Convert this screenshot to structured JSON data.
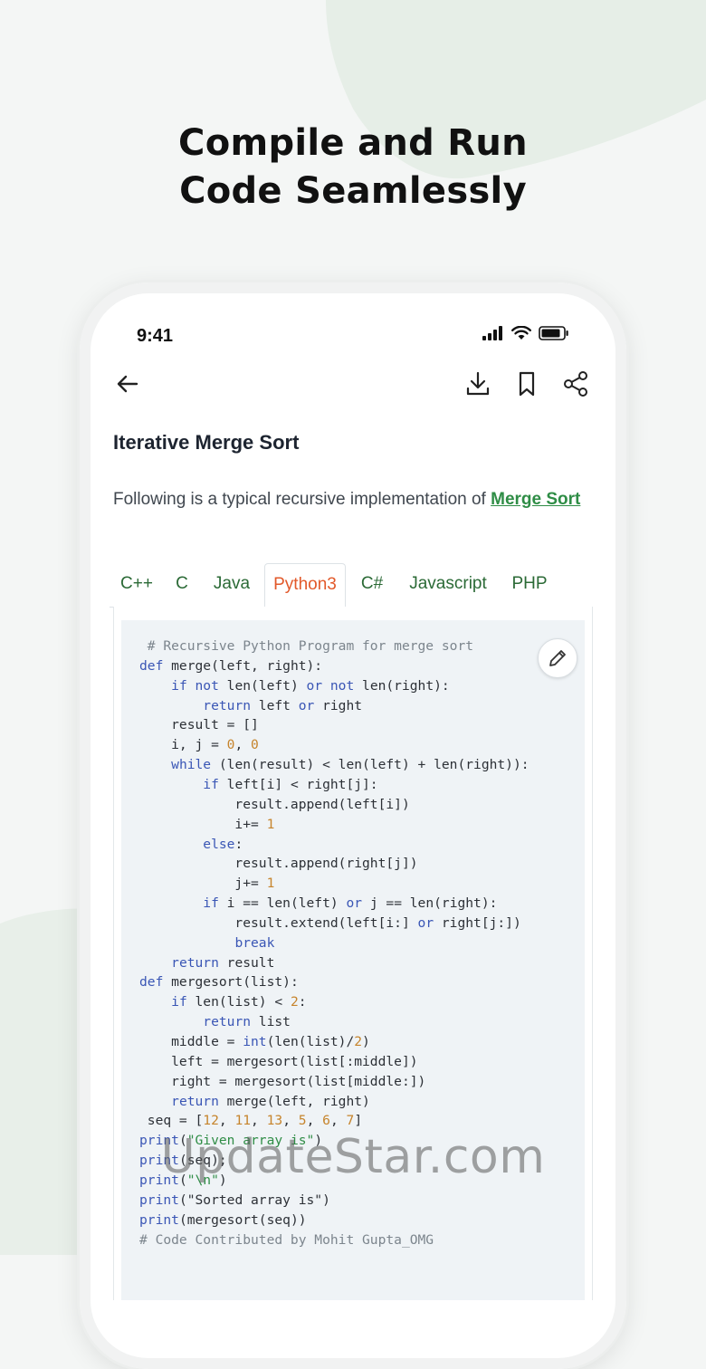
{
  "headline": {
    "line1": "Compile and Run",
    "line2": "Code Seamlessly"
  },
  "status_bar": {
    "time": "9:41"
  },
  "toolbar": {
    "back_icon": "arrow-left-icon",
    "download_icon": "download-icon",
    "bookmark_icon": "bookmark-icon",
    "share_icon": "share-icon"
  },
  "article": {
    "title": "Iterative Merge Sort",
    "intro_text": "Following is a typical recursive implementation of ",
    "intro_link": "Merge Sort"
  },
  "tabs": [
    {
      "label": "C++",
      "active": false
    },
    {
      "label": "C",
      "active": false
    },
    {
      "label": "Java",
      "active": false
    },
    {
      "label": "Python3",
      "active": true
    },
    {
      "label": "C#",
      "active": false
    },
    {
      "label": "Javascript",
      "active": false
    },
    {
      "label": "PHP",
      "active": false
    }
  ],
  "code": {
    "edit_icon": "pencil-icon",
    "lines": [
      [
        [
          "c",
          " # Recursive Python Program for merge sort"
        ]
      ],
      [
        [
          "k",
          "def"
        ],
        [
          "t",
          " merge(left, right):"
        ]
      ],
      [
        [
          "t",
          "    "
        ],
        [
          "k",
          "if not"
        ],
        [
          "t",
          " len(left) "
        ],
        [
          "k",
          "or not"
        ],
        [
          "t",
          " len(right):"
        ]
      ],
      [
        [
          "t",
          "        "
        ],
        [
          "k",
          "return"
        ],
        [
          "t",
          " left "
        ],
        [
          "k",
          "or"
        ],
        [
          "t",
          " right"
        ]
      ],
      [
        [
          "t",
          "    result = []"
        ]
      ],
      [
        [
          "t",
          "    i, j = "
        ],
        [
          "n",
          "0"
        ],
        [
          "t",
          ", "
        ],
        [
          "n",
          "0"
        ]
      ],
      [
        [
          "t",
          "    "
        ],
        [
          "k",
          "while"
        ],
        [
          "t",
          " (len(result) < len(left) + len(right)):"
        ]
      ],
      [
        [
          "t",
          "        "
        ],
        [
          "k",
          "if"
        ],
        [
          "t",
          " left[i] < right[j]:"
        ]
      ],
      [
        [
          "t",
          "            result.append(left[i])"
        ]
      ],
      [
        [
          "t",
          "            i+= "
        ],
        [
          "n",
          "1"
        ]
      ],
      [
        [
          "t",
          "        "
        ],
        [
          "k",
          "else"
        ],
        [
          "t",
          ":"
        ]
      ],
      [
        [
          "t",
          "            result.append(right[j])"
        ]
      ],
      [
        [
          "t",
          "            j+= "
        ],
        [
          "n",
          "1"
        ]
      ],
      [
        [
          "t",
          "        "
        ],
        [
          "k",
          "if"
        ],
        [
          "t",
          " i == len(left) "
        ],
        [
          "k",
          "or"
        ],
        [
          "t",
          " j == len(right):"
        ]
      ],
      [
        [
          "t",
          "            result.extend(left[i:] "
        ],
        [
          "k",
          "or"
        ],
        [
          "t",
          " right[j:])"
        ]
      ],
      [
        [
          "t",
          "            "
        ],
        [
          "k",
          "break"
        ]
      ],
      [
        [
          "t",
          "    "
        ],
        [
          "k",
          "return"
        ],
        [
          "t",
          " result"
        ]
      ],
      [
        [
          "k",
          "def"
        ],
        [
          "t",
          " mergesort(list):"
        ]
      ],
      [
        [
          "t",
          "    "
        ],
        [
          "k",
          "if"
        ],
        [
          "t",
          " len(list) < "
        ],
        [
          "n",
          "2"
        ],
        [
          "t",
          ":"
        ]
      ],
      [
        [
          "t",
          "        "
        ],
        [
          "k",
          "return"
        ],
        [
          "t",
          " list"
        ]
      ],
      [
        [
          "t",
          "    middle = "
        ],
        [
          "k",
          "int"
        ],
        [
          "t",
          "(len(list)/"
        ],
        [
          "n",
          "2"
        ],
        [
          "t",
          ")"
        ]
      ],
      [
        [
          "t",
          "    left = mergesort(list[:middle])"
        ]
      ],
      [
        [
          "t",
          "    right = mergesort(list[middle:])"
        ]
      ],
      [
        [
          "t",
          "    "
        ],
        [
          "k",
          "return"
        ],
        [
          "t",
          " merge(left, right)"
        ]
      ],
      [
        [
          "t",
          " seq = ["
        ],
        [
          "n",
          "12"
        ],
        [
          "t",
          ", "
        ],
        [
          "n",
          "11"
        ],
        [
          "t",
          ", "
        ],
        [
          "n",
          "13"
        ],
        [
          "t",
          ", "
        ],
        [
          "n",
          "5"
        ],
        [
          "t",
          ", "
        ],
        [
          "n",
          "6"
        ],
        [
          "t",
          ", "
        ],
        [
          "n",
          "7"
        ],
        [
          "t",
          "]"
        ]
      ],
      [
        [
          "k",
          "print"
        ],
        [
          "t",
          "("
        ],
        [
          "s",
          "\"Given array is\""
        ],
        [
          "t",
          ")"
        ]
      ],
      [
        [
          "k",
          "print"
        ],
        [
          "t",
          "(seq);"
        ]
      ],
      [
        [
          "k",
          "print"
        ],
        [
          "t",
          "("
        ],
        [
          "s",
          "\"\\n\""
        ],
        [
          "t",
          ")"
        ]
      ],
      [
        [
          "k",
          "print"
        ],
        [
          "t",
          "(\"Sorted array is\")"
        ]
      ],
      [
        [
          "k",
          "print"
        ],
        [
          "t",
          "(mergesort(seq))"
        ]
      ],
      [
        [
          "c",
          "# Code Contributed by Mohit Gupta_OMG"
        ]
      ]
    ]
  },
  "watermark": "UpdateStar.com",
  "colors": {
    "accent_green": "#2f8d46",
    "active_tab": "#e2592a",
    "keyword": "#3a56b5",
    "number": "#c6842c",
    "string": "#2f8d46",
    "comment": "#7c858d"
  }
}
